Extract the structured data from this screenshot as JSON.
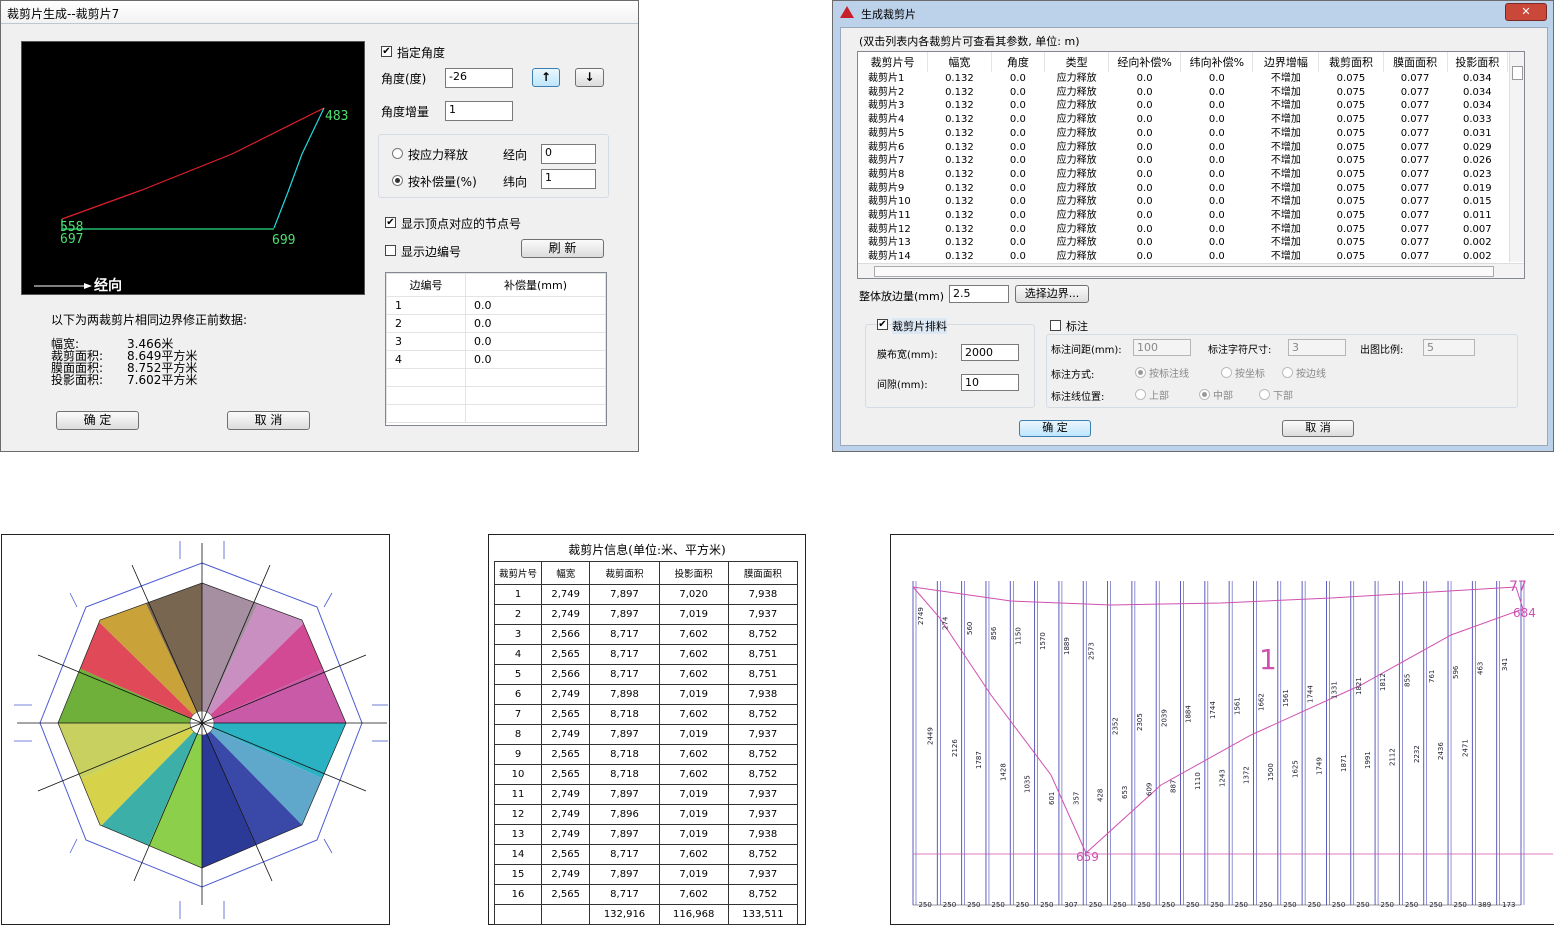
{
  "dlg1": {
    "title": "裁剪片生成--裁剪片7",
    "specify_angle_label": "指定角度",
    "specify_angle_checked": true,
    "angle_label": "角度(度)",
    "angle_value": "-26",
    "up_arrow": "↑",
    "down_arrow": "↓",
    "angle_inc_label": "角度增量",
    "angle_inc_value": "1",
    "opt_stress": "按应力释放",
    "opt_comp": "按补偿量(%)",
    "warp_label": "经向",
    "warp_value": "0",
    "weft_label": "纬向",
    "weft_value": "1",
    "show_node_label": "显示顶点对应的节点号",
    "show_node_checked": true,
    "show_edge_label": "显示边编号",
    "show_edge_checked": false,
    "refresh": "刷 新",
    "edge_table": {
      "headers": [
        "边编号",
        "补偿量(mm)"
      ],
      "rows": [
        [
          "1",
          "0.0"
        ],
        [
          "2",
          "0.0"
        ],
        [
          "3",
          "0.0"
        ],
        [
          "4",
          "0.0"
        ]
      ]
    },
    "preview": {
      "nodes": {
        "n483": "483",
        "n558": "558",
        "n697": "697",
        "n699": "699"
      },
      "direction": "经向"
    },
    "note": "以下为两裁剪片相同边界修正前数据:",
    "stats": [
      {
        "k": "幅宽:",
        "v": "3.466米"
      },
      {
        "k": "裁剪面积:",
        "v": "8.649平方米"
      },
      {
        "k": "膜面面积:",
        "v": "8.752平方米"
      },
      {
        "k": "投影面积:",
        "v": "7.602平方米"
      }
    ],
    "ok": "确 定",
    "cancel": "取 消"
  },
  "dlg2": {
    "title": "生成裁剪片",
    "hint": "(双击列表内各裁剪片可查看其参数, 单位: m)",
    "headers": [
      "裁剪片号",
      "幅宽",
      "角度",
      "类型",
      "经向补偿%",
      "纬向补偿%",
      "边界增幅",
      "裁剪面积",
      "膜面面积",
      "投影面积"
    ],
    "rows": [
      [
        "裁剪片1",
        "0.132",
        "0.0",
        "应力释放",
        "0.0",
        "0.0",
        "不增加",
        "0.075",
        "0.077",
        "0.034"
      ],
      [
        "裁剪片2",
        "0.132",
        "0.0",
        "应力释放",
        "0.0",
        "0.0",
        "不增加",
        "0.075",
        "0.077",
        "0.034"
      ],
      [
        "裁剪片3",
        "0.132",
        "0.0",
        "应力释放",
        "0.0",
        "0.0",
        "不增加",
        "0.075",
        "0.077",
        "0.034"
      ],
      [
        "裁剪片4",
        "0.132",
        "0.0",
        "应力释放",
        "0.0",
        "0.0",
        "不增加",
        "0.075",
        "0.077",
        "0.033"
      ],
      [
        "裁剪片5",
        "0.132",
        "0.0",
        "应力释放",
        "0.0",
        "0.0",
        "不增加",
        "0.075",
        "0.077",
        "0.031"
      ],
      [
        "裁剪片6",
        "0.132",
        "0.0",
        "应力释放",
        "0.0",
        "0.0",
        "不增加",
        "0.075",
        "0.077",
        "0.029"
      ],
      [
        "裁剪片7",
        "0.132",
        "0.0",
        "应力释放",
        "0.0",
        "0.0",
        "不增加",
        "0.075",
        "0.077",
        "0.026"
      ],
      [
        "裁剪片8",
        "0.132",
        "0.0",
        "应力释放",
        "0.0",
        "0.0",
        "不增加",
        "0.075",
        "0.077",
        "0.023"
      ],
      [
        "裁剪片9",
        "0.132",
        "0.0",
        "应力释放",
        "0.0",
        "0.0",
        "不增加",
        "0.075",
        "0.077",
        "0.019"
      ],
      [
        "裁剪片10",
        "0.132",
        "0.0",
        "应力释放",
        "0.0",
        "0.0",
        "不增加",
        "0.075",
        "0.077",
        "0.015"
      ],
      [
        "裁剪片11",
        "0.132",
        "0.0",
        "应力释放",
        "0.0",
        "0.0",
        "不增加",
        "0.075",
        "0.077",
        "0.011"
      ],
      [
        "裁剪片12",
        "0.132",
        "0.0",
        "应力释放",
        "0.0",
        "0.0",
        "不增加",
        "0.075",
        "0.077",
        "0.007"
      ],
      [
        "裁剪片13",
        "0.132",
        "0.0",
        "应力释放",
        "0.0",
        "0.0",
        "不增加",
        "0.075",
        "0.077",
        "0.002"
      ],
      [
        "裁剪片14",
        "0.132",
        "0.0",
        "应力释放",
        "0.0",
        "0.0",
        "不增加",
        "0.075",
        "0.077",
        "0.002"
      ]
    ],
    "overall_label": "整体放边量(mm)",
    "overall_value": "2.5",
    "select_border": "选择边界...",
    "layout_label": "裁剪片排料",
    "layout_checked": true,
    "cloth_width_label": "膜布宽(mm):",
    "cloth_width_value": "2000",
    "gap_label": "间隙(mm):",
    "gap_value": "10",
    "annot_label": "标注",
    "annot_checked": false,
    "annot_spacing_label": "标注间距(mm):",
    "annot_spacing_value": "100",
    "annot_char_label": "标注字符尺寸:",
    "annot_char_value": "3",
    "scale_label": "出图比例:",
    "scale_value": "5",
    "annot_mode_label": "标注方式:",
    "annot_modes": [
      "按标注线",
      "按坐标",
      "按边线"
    ],
    "annot_pos_label": "标注线位置:",
    "annot_positions": [
      "上部",
      "中部",
      "下部"
    ],
    "ok": "确 定",
    "cancel": "取 消"
  },
  "info_table": {
    "title": "裁剪片信息(单位:米、平方米)",
    "headers": [
      "裁剪片号",
      "幅宽",
      "裁剪面积",
      "投影面积",
      "膜面面积"
    ],
    "rows": [
      [
        "1",
        "2,749",
        "7,897",
        "7,020",
        "7,938"
      ],
      [
        "2",
        "2,749",
        "7,897",
        "7,019",
        "7,937"
      ],
      [
        "3",
        "2,566",
        "8,717",
        "7,602",
        "8,752"
      ],
      [
        "4",
        "2,565",
        "8,717",
        "7,602",
        "8,751"
      ],
      [
        "5",
        "2,566",
        "8,717",
        "7,602",
        "8,751"
      ],
      [
        "6",
        "2,749",
        "7,898",
        "7,019",
        "7,938"
      ],
      [
        "7",
        "2,565",
        "8,718",
        "7,602",
        "8,752"
      ],
      [
        "8",
        "2,749",
        "7,897",
        "7,019",
        "7,937"
      ],
      [
        "9",
        "2,565",
        "8,718",
        "7,602",
        "8,752"
      ],
      [
        "10",
        "2,565",
        "8,718",
        "7,602",
        "8,752"
      ],
      [
        "11",
        "2,749",
        "7,897",
        "7,019",
        "7,937"
      ],
      [
        "12",
        "2,749",
        "7,896",
        "7,019",
        "7,937"
      ],
      [
        "13",
        "2,749",
        "7,897",
        "7,019",
        "7,938"
      ],
      [
        "14",
        "2,565",
        "8,717",
        "7,602",
        "8,752"
      ],
      [
        "15",
        "2,749",
        "7,897",
        "7,019",
        "7,937"
      ],
      [
        "16",
        "2,565",
        "8,717",
        "7,602",
        "8,752"
      ]
    ],
    "totals": [
      "",
      "",
      "132,916",
      "116,968",
      "133,511"
    ]
  },
  "pattern_drawing": {
    "node_labels": {
      "a": "77",
      "b": "684",
      "c": "659",
      "d": "1"
    },
    "top_dims": [
      "2749",
      "274",
      "560",
      "856",
      "1150",
      "1570",
      "1889",
      "2573",
      "2352",
      "2305",
      "2039",
      "1884",
      "1744",
      "1561",
      "1662",
      "1561",
      "1744",
      "1331",
      "1821",
      "1812",
      "855",
      "761",
      "596",
      "463",
      "341"
    ],
    "mid_dims": [
      "2449",
      "2126",
      "1787",
      "1428",
      "1035",
      "601",
      "357",
      "428",
      "653",
      "609",
      "887",
      "1110",
      "1243",
      "1372",
      "1500",
      "1625",
      "1749",
      "1871",
      "1991",
      "2112",
      "2232",
      "2436",
      "2471"
    ],
    "bottom_dims": [
      "250",
      "250",
      "250",
      "250",
      "250",
      "250",
      "307",
      "250",
      "250",
      "250",
      "250",
      "250",
      "250",
      "250",
      "250",
      "250",
      "250",
      "250",
      "250",
      "250",
      "250",
      "250",
      "250",
      "389",
      "173"
    ]
  },
  "colors": {
    "preview_bg": "#000000",
    "edge_red": "#e0202a",
    "edge_cyan": "#22d8e0",
    "edge_green": "#28e080",
    "node_text": "#4ce070",
    "pattern_line": "#4a4ab8",
    "pattern_pink": "#d050b0"
  }
}
